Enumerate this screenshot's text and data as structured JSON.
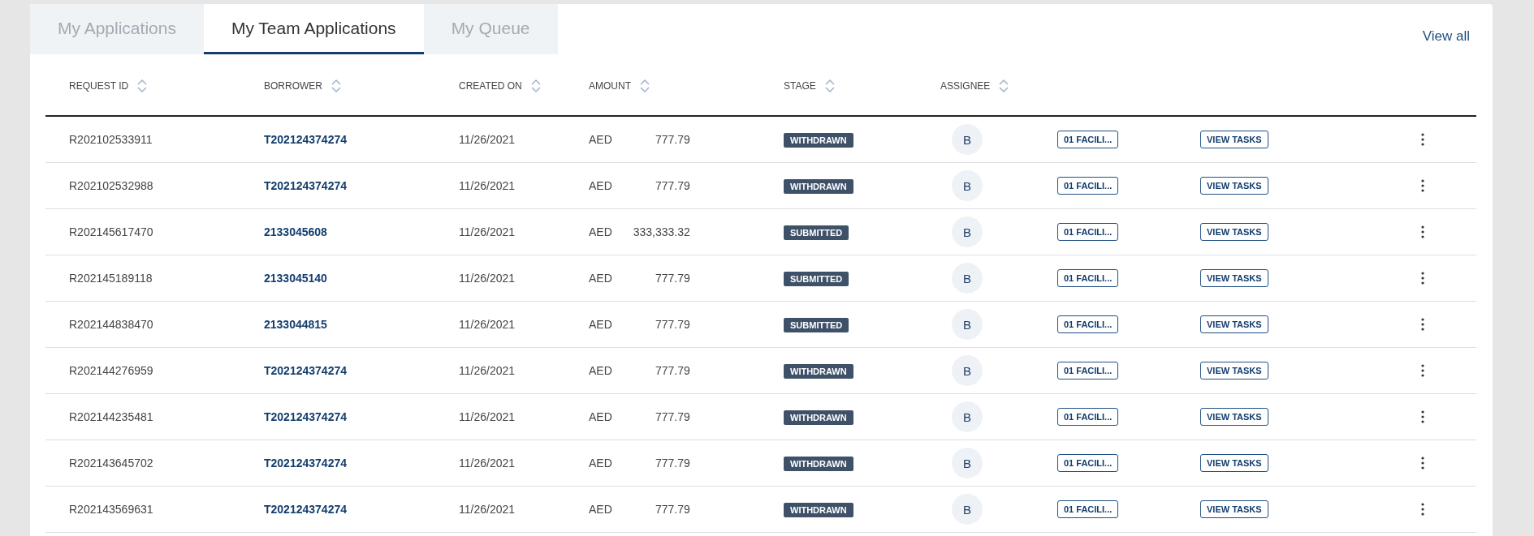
{
  "tabs": [
    {
      "label": "My Applications",
      "selected": false
    },
    {
      "label": "My Team Applications",
      "selected": true
    },
    {
      "label": "My Queue",
      "selected": false
    }
  ],
  "view_all": "View all",
  "table": {
    "columns": [
      "REQUEST ID",
      "BORROWER",
      "CREATED ON",
      "AMOUNT",
      "STAGE",
      "ASSIGNEE"
    ],
    "rows": [
      {
        "request_id": "R202102533911",
        "borrower": "T202124374274",
        "created_on": "11/26/2021",
        "currency": "AED",
        "amount": "777.79",
        "stage": "WITHDRAWN",
        "assignee": "B",
        "facility": "01 FACILI...",
        "action": "VIEW TASKS"
      },
      {
        "request_id": "R202102532988",
        "borrower": "T202124374274",
        "created_on": "11/26/2021",
        "currency": "AED",
        "amount": "777.79",
        "stage": "WITHDRAWN",
        "assignee": "B",
        "facility": "01 FACILI...",
        "action": "VIEW TASKS"
      },
      {
        "request_id": "R202145617470",
        "borrower": "2133045608",
        "created_on": "11/26/2021",
        "currency": "AED",
        "amount": "333,333.32",
        "stage": "SUBMITTED",
        "assignee": "B",
        "facility": "01 FACILI...",
        "action": "VIEW TASKS"
      },
      {
        "request_id": "R202145189118",
        "borrower": "2133045140",
        "created_on": "11/26/2021",
        "currency": "AED",
        "amount": "777.79",
        "stage": "SUBMITTED",
        "assignee": "B",
        "facility": "01 FACILI...",
        "action": "VIEW TASKS"
      },
      {
        "request_id": "R202144838470",
        "borrower": "2133044815",
        "created_on": "11/26/2021",
        "currency": "AED",
        "amount": "777.79",
        "stage": "SUBMITTED",
        "assignee": "B",
        "facility": "01 FACILI...",
        "action": "VIEW TASKS"
      },
      {
        "request_id": "R202144276959",
        "borrower": "T202124374274",
        "created_on": "11/26/2021",
        "currency": "AED",
        "amount": "777.79",
        "stage": "WITHDRAWN",
        "assignee": "B",
        "facility": "01 FACILI...",
        "action": "VIEW TASKS"
      },
      {
        "request_id": "R202144235481",
        "borrower": "T202124374274",
        "created_on": "11/26/2021",
        "currency": "AED",
        "amount": "777.79",
        "stage": "WITHDRAWN",
        "assignee": "B",
        "facility": "01 FACILI...",
        "action": "VIEW TASKS"
      },
      {
        "request_id": "R202143645702",
        "borrower": "T202124374274",
        "created_on": "11/26/2021",
        "currency": "AED",
        "amount": "777.79",
        "stage": "WITHDRAWN",
        "assignee": "B",
        "facility": "01 FACILI...",
        "action": "VIEW TASKS"
      },
      {
        "request_id": "R202143569631",
        "borrower": "T202124374274",
        "created_on": "11/26/2021",
        "currency": "AED",
        "amount": "777.79",
        "stage": "WITHDRAWN",
        "assignee": "B",
        "facility": "01 FACILI...",
        "action": "VIEW TASKS"
      }
    ]
  }
}
